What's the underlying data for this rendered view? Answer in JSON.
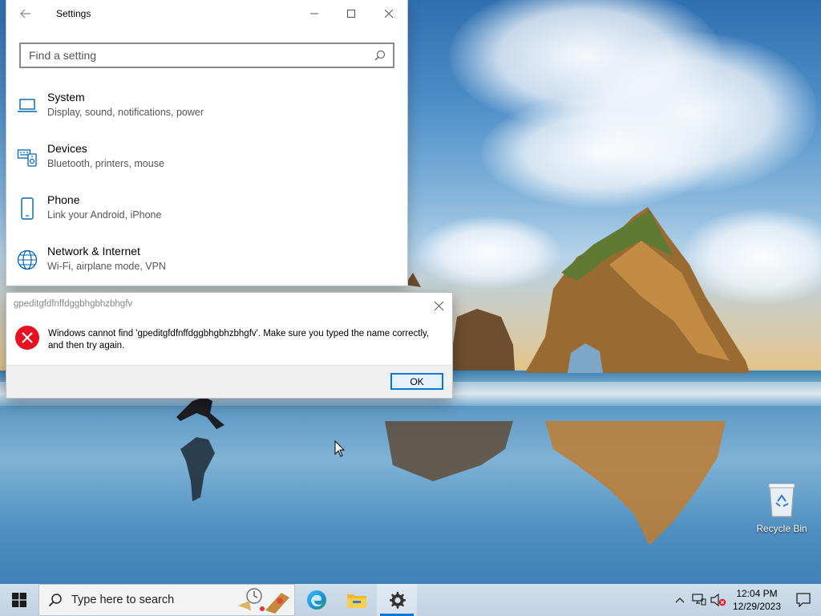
{
  "settings_window": {
    "title": "Settings",
    "search_placeholder": "Find a setting",
    "categories": [
      {
        "name": "System",
        "description": "Display, sound, notifications, power",
        "icon": "laptop-icon"
      },
      {
        "name": "Devices",
        "description": "Bluetooth, printers, mouse",
        "icon": "devices-icon"
      },
      {
        "name": "Phone",
        "description": "Link your Android, iPhone",
        "icon": "phone-icon"
      },
      {
        "name": "Network & Internet",
        "description": "Wi-Fi, airplane mode, VPN",
        "icon": "globe-icon"
      }
    ]
  },
  "error_dialog": {
    "title": "gpeditgfdfnffdggbhgbhzbhgfv",
    "message": "Windows cannot find 'gpeditgfdfnffdggbhgbhzbhgfv'. Make sure you typed the name correctly, and then try again.",
    "ok_label": "OK"
  },
  "desktop": {
    "icons": [
      {
        "label": "Recycle Bin",
        "icon": "recycle-bin-icon"
      }
    ]
  },
  "taskbar": {
    "search_placeholder": "Type here to search",
    "pinned": [
      {
        "name": "Microsoft Edge",
        "icon": "edge-icon"
      },
      {
        "name": "File Explorer",
        "icon": "folder-icon"
      },
      {
        "name": "Settings",
        "icon": "gear-icon",
        "active": true
      }
    ],
    "clock": {
      "time": "12:04 PM",
      "date": "12/29/2023"
    }
  },
  "colors": {
    "accent": "#0078d7",
    "error_red": "#e81123",
    "settings_icon_blue": "#0063b1"
  }
}
